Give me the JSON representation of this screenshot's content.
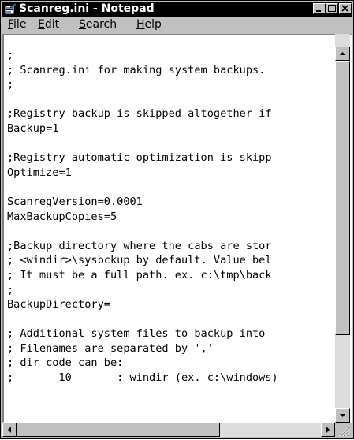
{
  "window": {
    "title": "Scanreg.ini - Notepad"
  },
  "menu": {
    "items": [
      "File",
      "Edit",
      "Search",
      "Help"
    ]
  },
  "document": {
    "lines": [
      ";",
      "; Scanreg.ini for making system backups.",
      ";",
      "",
      ";Registry backup is skipped altogether if",
      "Backup=1",
      "",
      ";Registry automatic optimization is skipp",
      "Optimize=1",
      "",
      "ScanregVersion=0.0001",
      "MaxBackupCopies=5",
      "",
      ";Backup directory where the cabs are stor",
      "; <windir>\\sysbckup by default. Value bel",
      "; It must be a full path. ex. c:\\tmp\\back",
      ";",
      "BackupDirectory=",
      "",
      "; Additional system files to backup into",
      "; Filenames are separated by ','",
      "; dir code can be:",
      ";       10       : windir (ex. c:\\windows)"
    ]
  },
  "scroll": {
    "vertical_position": 0.0,
    "horizontal_position": 0.0
  },
  "colors": {
    "title_bar": "#000000",
    "face": "#c0c0c0",
    "text_bg": "#ffffff"
  },
  "icons": {
    "app": "notepad-icon",
    "minimize": "minimize-icon",
    "maximize": "maximize-icon",
    "close": "close-icon"
  }
}
